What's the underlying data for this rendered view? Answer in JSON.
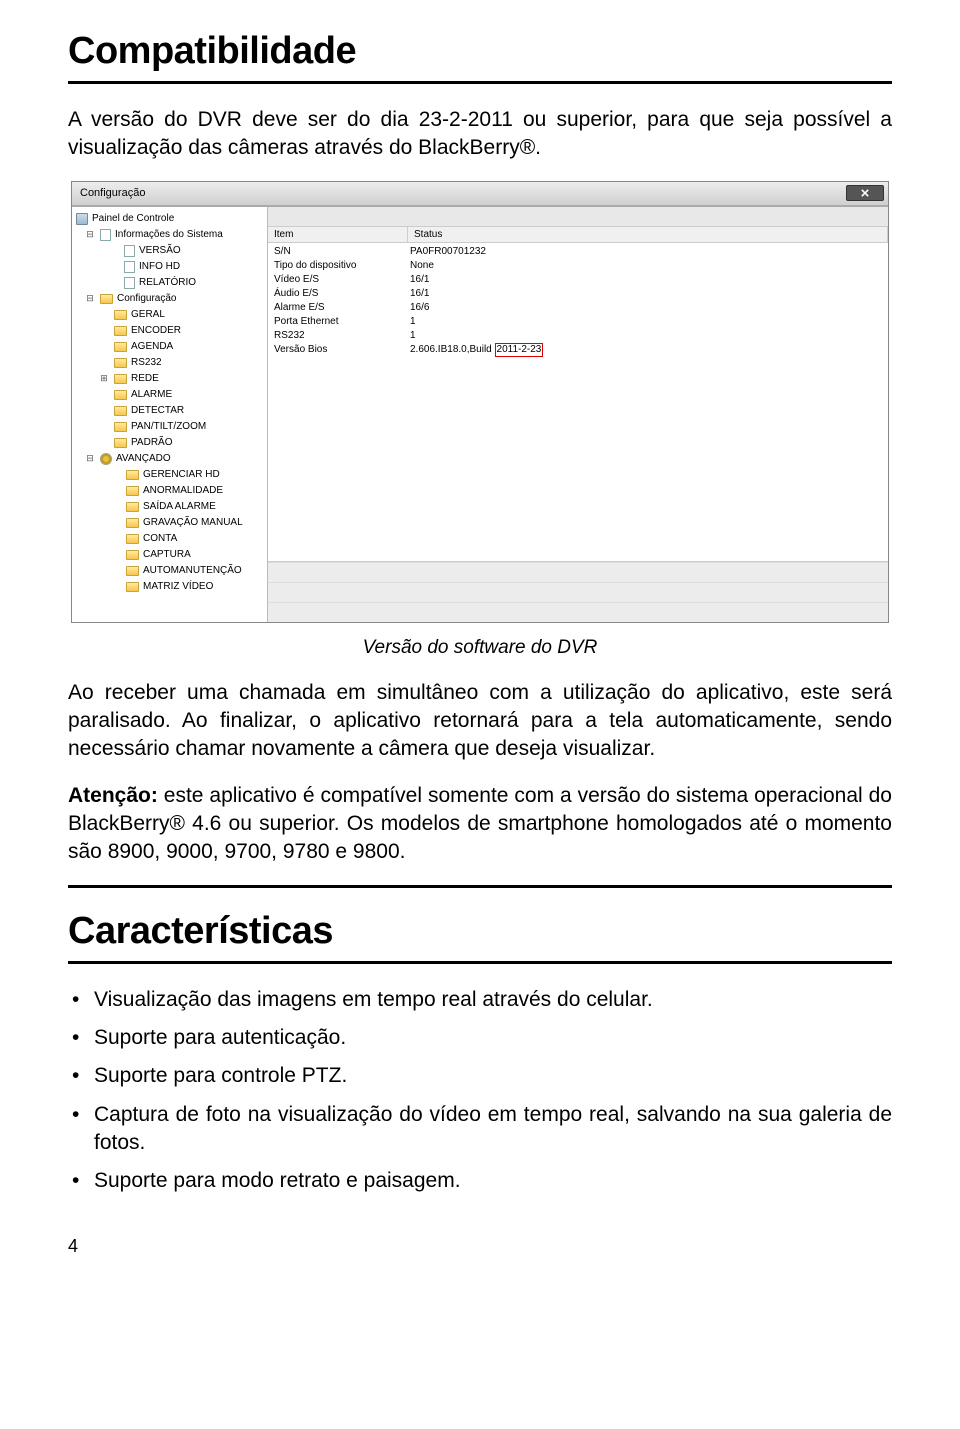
{
  "section1_heading": "Compatibilidade",
  "section1_p1": "A versão do DVR deve ser do dia 23-2-2011 ou superior, para que seja possível a visualização das câmeras através do BlackBerry®.",
  "window": {
    "title": "Configuração",
    "tree": {
      "root": "Painel de Controle",
      "info": "Informações do Sistema",
      "info_children": [
        "VERSÃO",
        "INFO HD",
        "RELATÓRIO"
      ],
      "config": "Configuração",
      "config_children": [
        "GERAL",
        "ENCODER",
        "AGENDA",
        "RS232",
        "REDE",
        "ALARME",
        "DETECTAR",
        "PAN/TILT/ZOOM",
        "PADRÃO"
      ],
      "advanced": "AVANÇADO",
      "advanced_children": [
        "GERENCIAR HD",
        "ANORMALIDADE",
        "SAÍDA ALARME",
        "GRAVAÇÃO MANUAL",
        "CONTA",
        "CAPTURA",
        "AUTOMANUTENÇÃO",
        "MATRIZ VÍDEO"
      ]
    },
    "table": {
      "header_item": "Item",
      "header_status": "Status",
      "rows": [
        {
          "item": "S/N",
          "status": "PA0FR00701232"
        },
        {
          "item": "Tipo do dispositivo",
          "status": "None"
        },
        {
          "item": "Vídeo E/S",
          "status": "16/1"
        },
        {
          "item": "Áudio E/S",
          "status": "16/1"
        },
        {
          "item": "Alarme E/S",
          "status": "16/6"
        },
        {
          "item": "Porta Ethernet",
          "status": "1"
        },
        {
          "item": "RS232",
          "status": "1"
        },
        {
          "item": "Versão Bios",
          "status_prefix": "2.606.IB18.0,Build ",
          "status_highlight": "2011-2-23"
        }
      ]
    }
  },
  "caption": "Versão do software do DVR",
  "section1_p2": "Ao receber uma chamada em simultâneo com a utilização do aplicativo, este será paralisado. Ao finalizar, o aplicativo retornará para a tela automaticamente, sendo necessário chamar novamente a câmera que deseja visualizar.",
  "attention_label": "Atenção:",
  "attention_text": " este aplicativo é compatível somente com a versão do sistema operacional do BlackBerry® 4.6 ou superior. Os modelos de smartphone homologados até o momento são 8900, 9000, 9700, 9780 e 9800.",
  "section2_heading": "Características",
  "bullets": [
    "Visualização das imagens em tempo real através do celular.",
    "Suporte para autenticação.",
    "Suporte para controle PTZ.",
    "Captura de foto na visualização do vídeo em tempo real, salvando na sua galeria de fotos.",
    "Suporte para modo retrato e paisagem."
  ],
  "page_num": "4"
}
